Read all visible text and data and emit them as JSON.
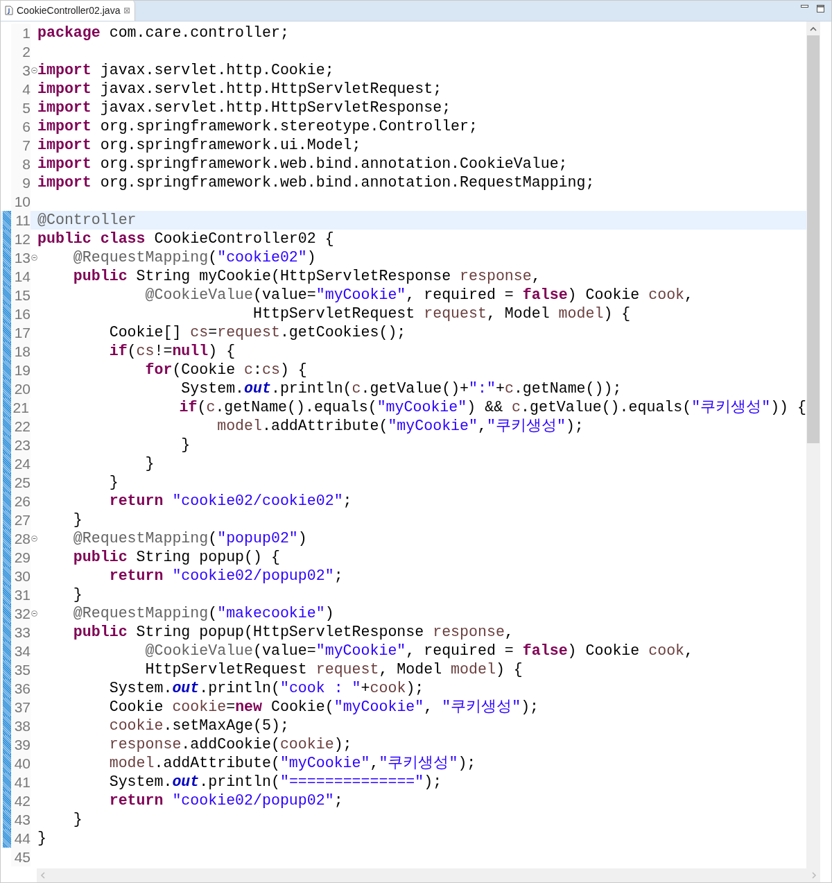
{
  "tab": {
    "title": "CookieController02.java",
    "selected": true,
    "close": "⊠"
  },
  "lines": [
    {
      "number": "1",
      "changed": false,
      "fold": false,
      "current": false,
      "tokens": [
        {
          "kind": "keyword",
          "text": "package"
        },
        {
          "kind": "plain",
          "text": " com.care.controller;"
        }
      ]
    },
    {
      "number": "2",
      "changed": false,
      "fold": false,
      "current": false
    },
    {
      "number": "3",
      "changed": false,
      "fold": true,
      "current": false,
      "tokens": [
        {
          "kind": "keyword",
          "text": "import"
        },
        {
          "kind": "plain",
          "text": " javax.servlet.http.Cookie;"
        }
      ]
    },
    {
      "number": "4",
      "changed": false,
      "fold": false,
      "current": false,
      "tokens": [
        {
          "kind": "keyword",
          "text": "import"
        },
        {
          "kind": "plain",
          "text": " javax.servlet.http.HttpServletRequest;"
        }
      ]
    },
    {
      "number": "5",
      "changed": false,
      "fold": false,
      "current": false,
      "tokens": [
        {
          "kind": "keyword",
          "text": "import"
        },
        {
          "kind": "plain",
          "text": " javax.servlet.http.HttpServletResponse;"
        }
      ]
    },
    {
      "number": "6",
      "changed": false,
      "fold": false,
      "current": false,
      "tokens": [
        {
          "kind": "keyword",
          "text": "import"
        },
        {
          "kind": "plain",
          "text": " org.springframework.stereotype.Controller;"
        }
      ]
    },
    {
      "number": "7",
      "changed": false,
      "fold": false,
      "current": false,
      "tokens": [
        {
          "kind": "keyword",
          "text": "import"
        },
        {
          "kind": "plain",
          "text": " org.springframework.ui.Model;"
        }
      ]
    },
    {
      "number": "8",
      "changed": false,
      "fold": false,
      "current": false,
      "tokens": [
        {
          "kind": "keyword",
          "text": "import"
        },
        {
          "kind": "plain",
          "text": " org.springframework.web.bind.annotation.CookieValue;"
        }
      ]
    },
    {
      "number": "9",
      "changed": false,
      "fold": false,
      "current": false,
      "tokens": [
        {
          "kind": "keyword",
          "text": "import"
        },
        {
          "kind": "plain",
          "text": " org.springframework.web.bind.annotation.RequestMapping;"
        }
      ]
    },
    {
      "number": "10",
      "changed": false,
      "fold": false,
      "current": false
    },
    {
      "number": "11",
      "changed": true,
      "fold": false,
      "current": true,
      "tokens": [
        {
          "kind": "annotation",
          "text": "@Controller"
        }
      ]
    },
    {
      "number": "12",
      "changed": true,
      "fold": false,
      "current": false,
      "tokens": [
        {
          "kind": "keyword",
          "text": "public class"
        },
        {
          "kind": "plain",
          "text": " CookieController02 {"
        }
      ]
    },
    {
      "number": "13",
      "changed": true,
      "fold": true,
      "current": false,
      "tokens": [
        {
          "kind": "annotation",
          "text": "    @RequestMapping"
        },
        {
          "kind": "plain",
          "text": "("
        },
        {
          "kind": "string",
          "text": "\"cookie02\""
        },
        {
          "kind": "plain",
          "text": ")"
        }
      ]
    },
    {
      "number": "14",
      "changed": true,
      "fold": false,
      "current": false,
      "tokens": [
        {
          "kind": "keyword",
          "text": "    public"
        },
        {
          "kind": "plain",
          "text": " String myCookie(HttpServletResponse "
        },
        {
          "kind": "variable",
          "text": "response"
        },
        {
          "kind": "plain",
          "text": ","
        }
      ]
    },
    {
      "number": "15",
      "changed": true,
      "fold": false,
      "current": false,
      "tokens": [
        {
          "kind": "annotation",
          "text": "            @CookieValue"
        },
        {
          "kind": "plain",
          "text": "(value="
        },
        {
          "kind": "string",
          "text": "\"myCookie\""
        },
        {
          "kind": "plain",
          "text": ", required = "
        },
        {
          "kind": "keyword",
          "text": "false"
        },
        {
          "kind": "plain",
          "text": ") Cookie "
        },
        {
          "kind": "variable",
          "text": "cook"
        },
        {
          "kind": "plain",
          "text": ","
        }
      ]
    },
    {
      "number": "16",
      "changed": true,
      "fold": false,
      "current": false,
      "tokens": [
        {
          "kind": "plain",
          "text": "                        HttpServletRequest "
        },
        {
          "kind": "variable",
          "text": "request"
        },
        {
          "kind": "plain",
          "text": ", Model "
        },
        {
          "kind": "variable",
          "text": "model"
        },
        {
          "kind": "plain",
          "text": ") {"
        }
      ]
    },
    {
      "number": "17",
      "changed": true,
      "fold": false,
      "current": false,
      "tokens": [
        {
          "kind": "plain",
          "text": "        Cookie[] "
        },
        {
          "kind": "variable",
          "text": "cs"
        },
        {
          "kind": "plain",
          "text": "="
        },
        {
          "kind": "variable",
          "text": "request"
        },
        {
          "kind": "plain",
          "text": ".getCookies();"
        }
      ]
    },
    {
      "number": "18",
      "changed": true,
      "fold": false,
      "current": false,
      "tokens": [
        {
          "kind": "keyword",
          "text": "        if"
        },
        {
          "kind": "plain",
          "text": "("
        },
        {
          "kind": "variable",
          "text": "cs"
        },
        {
          "kind": "plain",
          "text": "!="
        },
        {
          "kind": "keyword",
          "text": "null"
        },
        {
          "kind": "plain",
          "text": ") {"
        }
      ]
    },
    {
      "number": "19",
      "changed": true,
      "fold": false,
      "current": false,
      "tokens": [
        {
          "kind": "keyword",
          "text": "            for"
        },
        {
          "kind": "plain",
          "text": "(Cookie "
        },
        {
          "kind": "variable",
          "text": "c"
        },
        {
          "kind": "plain",
          "text": ":"
        },
        {
          "kind": "variable",
          "text": "cs"
        },
        {
          "kind": "plain",
          "text": ") {"
        }
      ]
    },
    {
      "number": "20",
      "changed": true,
      "fold": false,
      "current": false,
      "tokens": [
        {
          "kind": "plain",
          "text": "                System."
        },
        {
          "kind": "field",
          "text": "out"
        },
        {
          "kind": "plain",
          "text": ".println("
        },
        {
          "kind": "variable",
          "text": "c"
        },
        {
          "kind": "plain",
          "text": ".getValue()+"
        },
        {
          "kind": "string",
          "text": "\":\""
        },
        {
          "kind": "plain",
          "text": "+"
        },
        {
          "kind": "variable",
          "text": "c"
        },
        {
          "kind": "plain",
          "text": ".getName());"
        }
      ]
    },
    {
      "number": "21",
      "changed": true,
      "fold": false,
      "current": false,
      "tokens": [
        {
          "kind": "keyword",
          "text": "                if"
        },
        {
          "kind": "plain",
          "text": "("
        },
        {
          "kind": "variable",
          "text": "c"
        },
        {
          "kind": "plain",
          "text": ".getName().equals("
        },
        {
          "kind": "string",
          "text": "\"myCookie\""
        },
        {
          "kind": "plain",
          "text": ") && "
        },
        {
          "kind": "variable",
          "text": "c"
        },
        {
          "kind": "plain",
          "text": ".getValue().equals("
        },
        {
          "kind": "string",
          "text": "\"쿠키생성\""
        },
        {
          "kind": "plain",
          "text": ")) {"
        }
      ]
    },
    {
      "number": "22",
      "changed": true,
      "fold": false,
      "current": false,
      "tokens": [
        {
          "kind": "variable",
          "text": "                    model"
        },
        {
          "kind": "plain",
          "text": ".addAttribute("
        },
        {
          "kind": "string",
          "text": "\"myCookie\""
        },
        {
          "kind": "plain",
          "text": ","
        },
        {
          "kind": "string",
          "text": "\"쿠키생성\""
        },
        {
          "kind": "plain",
          "text": ");"
        }
      ]
    },
    {
      "number": "23",
      "changed": true,
      "fold": false,
      "current": false,
      "tokens": [
        {
          "kind": "plain",
          "text": "                }"
        }
      ]
    },
    {
      "number": "24",
      "changed": true,
      "fold": false,
      "current": false,
      "tokens": [
        {
          "kind": "plain",
          "text": "            }"
        }
      ]
    },
    {
      "number": "25",
      "changed": true,
      "fold": false,
      "current": false,
      "tokens": [
        {
          "kind": "plain",
          "text": "        }"
        }
      ]
    },
    {
      "number": "26",
      "changed": true,
      "fold": false,
      "current": false,
      "tokens": [
        {
          "kind": "keyword",
          "text": "        return"
        },
        {
          "kind": "string",
          "text": " \"cookie02/cookie02\""
        },
        {
          "kind": "plain",
          "text": ";"
        }
      ]
    },
    {
      "number": "27",
      "changed": true,
      "fold": false,
      "current": false,
      "tokens": [
        {
          "kind": "plain",
          "text": "    }"
        }
      ]
    },
    {
      "number": "28",
      "changed": true,
      "fold": true,
      "current": false,
      "tokens": [
        {
          "kind": "annotation",
          "text": "    @RequestMapping"
        },
        {
          "kind": "plain",
          "text": "("
        },
        {
          "kind": "string",
          "text": "\"popup02\""
        },
        {
          "kind": "plain",
          "text": ")"
        }
      ]
    },
    {
      "number": "29",
      "changed": true,
      "fold": false,
      "current": false,
      "tokens": [
        {
          "kind": "keyword",
          "text": "    public"
        },
        {
          "kind": "plain",
          "text": " String popup() {"
        }
      ]
    },
    {
      "number": "30",
      "changed": true,
      "fold": false,
      "current": false,
      "tokens": [
        {
          "kind": "keyword",
          "text": "        return"
        },
        {
          "kind": "string",
          "text": " \"cookie02/popup02\""
        },
        {
          "kind": "plain",
          "text": ";"
        }
      ]
    },
    {
      "number": "31",
      "changed": true,
      "fold": false,
      "current": false,
      "tokens": [
        {
          "kind": "plain",
          "text": "    }"
        }
      ]
    },
    {
      "number": "32",
      "changed": true,
      "fold": true,
      "current": false,
      "tokens": [
        {
          "kind": "annotation",
          "text": "    @RequestMapping"
        },
        {
          "kind": "plain",
          "text": "("
        },
        {
          "kind": "string",
          "text": "\"makecookie\""
        },
        {
          "kind": "plain",
          "text": ")"
        }
      ]
    },
    {
      "number": "33",
      "changed": true,
      "fold": false,
      "current": false,
      "tokens": [
        {
          "kind": "keyword",
          "text": "    public"
        },
        {
          "kind": "plain",
          "text": " String popup(HttpServletResponse "
        },
        {
          "kind": "variable",
          "text": "response"
        },
        {
          "kind": "plain",
          "text": ","
        }
      ]
    },
    {
      "number": "34",
      "changed": true,
      "fold": false,
      "current": false,
      "tokens": [
        {
          "kind": "annotation",
          "text": "            @CookieValue"
        },
        {
          "kind": "plain",
          "text": "(value="
        },
        {
          "kind": "string",
          "text": "\"myCookie\""
        },
        {
          "kind": "plain",
          "text": ", required = "
        },
        {
          "kind": "keyword",
          "text": "false"
        },
        {
          "kind": "plain",
          "text": ") Cookie "
        },
        {
          "kind": "variable",
          "text": "cook"
        },
        {
          "kind": "plain",
          "text": ","
        }
      ]
    },
    {
      "number": "35",
      "changed": true,
      "fold": false,
      "current": false,
      "tokens": [
        {
          "kind": "plain",
          "text": "            HttpServletRequest "
        },
        {
          "kind": "variable",
          "text": "request"
        },
        {
          "kind": "plain",
          "text": ", Model "
        },
        {
          "kind": "variable",
          "text": "model"
        },
        {
          "kind": "plain",
          "text": ") {"
        }
      ]
    },
    {
      "number": "36",
      "changed": true,
      "fold": false,
      "current": false,
      "tokens": [
        {
          "kind": "plain",
          "text": "        System."
        },
        {
          "kind": "field",
          "text": "out"
        },
        {
          "kind": "plain",
          "text": ".println("
        },
        {
          "kind": "string",
          "text": "\"cook : \""
        },
        {
          "kind": "plain",
          "text": "+"
        },
        {
          "kind": "variable",
          "text": "cook"
        },
        {
          "kind": "plain",
          "text": ");"
        }
      ]
    },
    {
      "number": "37",
      "changed": true,
      "fold": false,
      "current": false,
      "tokens": [
        {
          "kind": "plain",
          "text": "        Cookie "
        },
        {
          "kind": "variable",
          "text": "cookie"
        },
        {
          "kind": "plain",
          "text": "="
        },
        {
          "kind": "keyword",
          "text": "new"
        },
        {
          "kind": "plain",
          "text": " Cookie("
        },
        {
          "kind": "string",
          "text": "\"myCookie\""
        },
        {
          "kind": "plain",
          "text": ", "
        },
        {
          "kind": "string",
          "text": "\"쿠키생성\""
        },
        {
          "kind": "plain",
          "text": ");"
        }
      ]
    },
    {
      "number": "38",
      "changed": true,
      "fold": false,
      "current": false,
      "tokens": [
        {
          "kind": "variable",
          "text": "        cookie"
        },
        {
          "kind": "plain",
          "text": ".setMaxAge(5);"
        }
      ]
    },
    {
      "number": "39",
      "changed": true,
      "fold": false,
      "current": false,
      "tokens": [
        {
          "kind": "variable",
          "text": "        response"
        },
        {
          "kind": "plain",
          "text": ".addCookie("
        },
        {
          "kind": "variable",
          "text": "cookie"
        },
        {
          "kind": "plain",
          "text": ");"
        }
      ]
    },
    {
      "number": "40",
      "changed": true,
      "fold": false,
      "current": false,
      "tokens": [
        {
          "kind": "variable",
          "text": "        model"
        },
        {
          "kind": "plain",
          "text": ".addAttribute("
        },
        {
          "kind": "string",
          "text": "\"myCookie\""
        },
        {
          "kind": "plain",
          "text": ","
        },
        {
          "kind": "string",
          "text": "\"쿠키생성\""
        },
        {
          "kind": "plain",
          "text": ");"
        }
      ]
    },
    {
      "number": "41",
      "changed": true,
      "fold": false,
      "current": false,
      "tokens": [
        {
          "kind": "plain",
          "text": "        System."
        },
        {
          "kind": "field",
          "text": "out"
        },
        {
          "kind": "plain",
          "text": ".println("
        },
        {
          "kind": "string",
          "text": "\"==============\""
        },
        {
          "kind": "plain",
          "text": ");"
        }
      ]
    },
    {
      "number": "42",
      "changed": true,
      "fold": false,
      "current": false,
      "tokens": [
        {
          "kind": "keyword",
          "text": "        return"
        },
        {
          "kind": "string",
          "text": " \"cookie02/popup02\""
        },
        {
          "kind": "plain",
          "text": ";"
        }
      ]
    },
    {
      "number": "43",
      "changed": true,
      "fold": false,
      "current": false,
      "tokens": [
        {
          "kind": "plain",
          "text": "    }"
        }
      ]
    },
    {
      "number": "44",
      "changed": true,
      "fold": false,
      "current": false,
      "tokens": [
        {
          "kind": "plain",
          "text": "}"
        }
      ]
    },
    {
      "number": "45",
      "changed": false,
      "fold": false,
      "current": false
    }
  ]
}
